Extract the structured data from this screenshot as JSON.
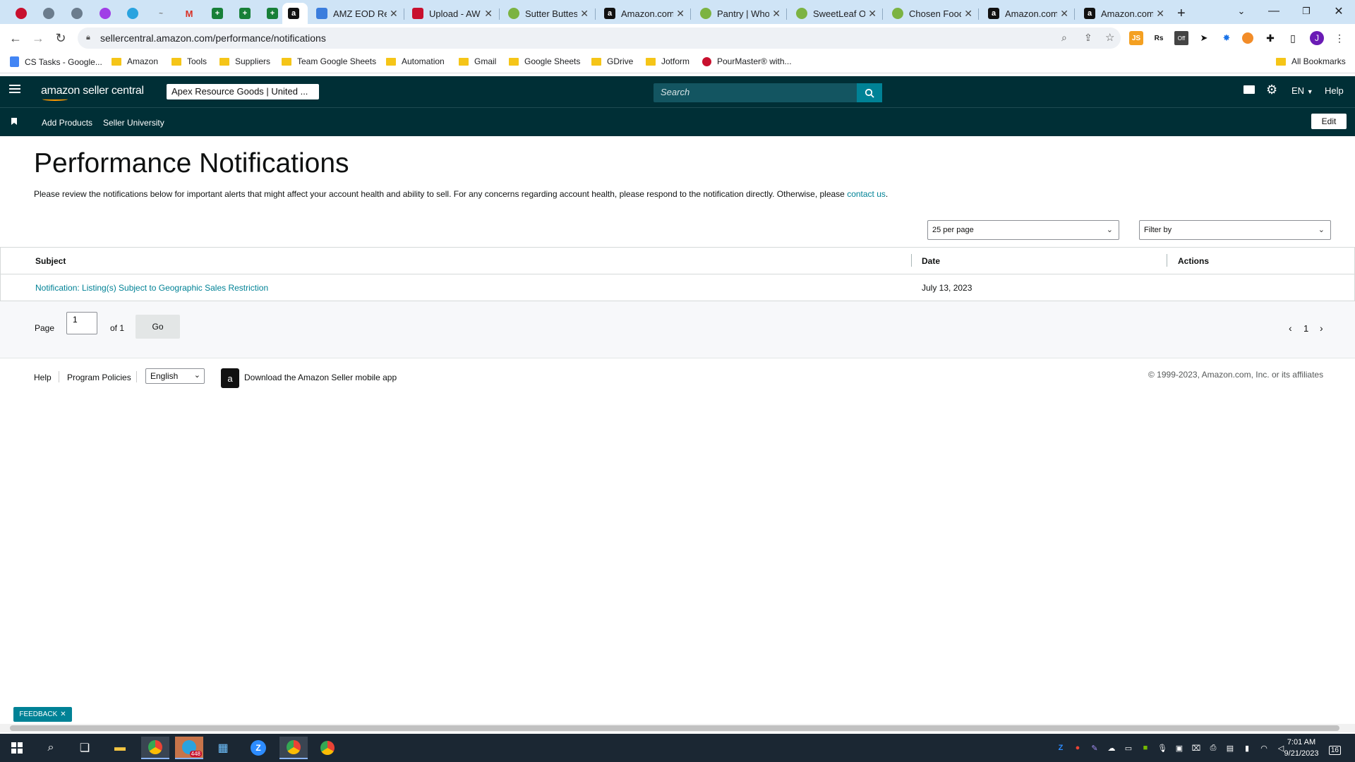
{
  "browser": {
    "tabs": [
      {
        "title": "",
        "active": false
      },
      {
        "title": "",
        "active": false
      },
      {
        "title": "",
        "active": false
      },
      {
        "title": "",
        "active": false
      },
      {
        "title": "",
        "active": false
      },
      {
        "title": "",
        "active": false
      },
      {
        "title": "",
        "active": false
      },
      {
        "title": "",
        "active": false
      },
      {
        "title": "",
        "active": false
      },
      {
        "title": "",
        "active": false
      },
      {
        "title": "",
        "active": true
      },
      {
        "title": "AMZ EOD Re",
        "active": false
      },
      {
        "title": "Upload - AW",
        "active": false
      },
      {
        "title": "Sutter Buttes",
        "active": false
      },
      {
        "title": "Amazon.com",
        "active": false
      },
      {
        "title": "Pantry | Who",
        "active": false
      },
      {
        "title": "SweetLeaf Or",
        "active": false
      },
      {
        "title": "Chosen Food",
        "active": false
      },
      {
        "title": "Amazon.com",
        "active": false
      },
      {
        "title": "Amazon.com",
        "active": false
      }
    ],
    "url": "sellercentral.amazon.com/performance/notifications",
    "bookmarks": [
      "CS Tasks - Google...",
      "Amazon",
      "Tools",
      "Suppliers",
      "Team Google Sheets",
      "Automation",
      "Gmail",
      "Google Sheets",
      "GDrive",
      "Jotform",
      "PourMaster® with..."
    ],
    "all_bookmarks": "All Bookmarks",
    "profile_initial": "J"
  },
  "header": {
    "logo": "amazon seller central",
    "store": "Apex Resource Goods | United ...",
    "search_placeholder": "Search",
    "language": "EN",
    "help": "Help"
  },
  "nav": {
    "items": [
      "Add Products",
      "Seller University"
    ],
    "edit": "Edit"
  },
  "main": {
    "title": "Performance Notifications",
    "description": "Please review the notifications below for important alerts that might affect your account health and ability to sell. For any concerns regarding account health, please respond to the notification directly. Otherwise, please ",
    "contact_link": "contact us",
    "description_end": ".",
    "per_page": "25 per page",
    "filter": "Filter by",
    "columns": {
      "subject": "Subject",
      "date": "Date",
      "actions": "Actions"
    },
    "rows": [
      {
        "subject": "Notification: Listing(s) Subject to Geographic Sales Restriction",
        "date": "July 13, 2023"
      }
    ],
    "pager": {
      "page_label": "Page",
      "page_value": "1",
      "of_label": "of 1",
      "go": "Go",
      "current": "1"
    }
  },
  "footer": {
    "help": "Help",
    "policies": "Program Policies",
    "language": "English",
    "app": "Download the Amazon Seller mobile app",
    "copyright": "© 1999-2023, Amazon.com, Inc. or its affiliates"
  },
  "feedback": "FEEDBACK",
  "taskbar": {
    "time": "7:01 AM",
    "date": "9/21/2023",
    "notifications": "16",
    "badge": "448"
  },
  "colors": {
    "header_bg": "#002f36",
    "accent": "#008296",
    "tabstrip": "#cfe4f6"
  }
}
